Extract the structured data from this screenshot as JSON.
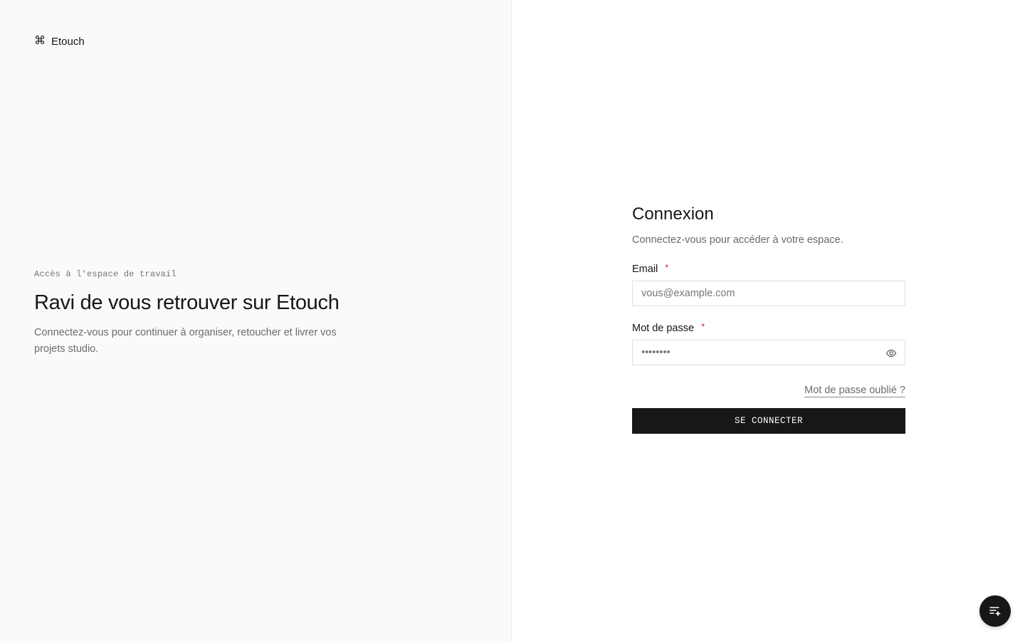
{
  "brand": {
    "icon": "command-icon",
    "icon_glyph": "⌘",
    "name": "Etouch"
  },
  "hero": {
    "eyebrow": "Accès à l'espace de travail",
    "title": "Ravi de vous retrouver sur Etouch",
    "subtitle": "Connectez-vous pour continuer à organiser, retoucher et livrer vos projets studio."
  },
  "form": {
    "title": "Connexion",
    "subtitle": "Connectez-vous pour accéder à votre espace.",
    "email": {
      "label": "Email",
      "required_mark": "*",
      "placeholder": "vous@example.com",
      "value": ""
    },
    "password": {
      "label": "Mot de passe",
      "required_mark": "*",
      "placeholder": "••••••••",
      "value": "",
      "toggle_icon": "eye-icon"
    },
    "forgot_link": "Mot de passe oublié ?",
    "submit_label": "SE CONNECTER"
  },
  "fab": {
    "icon": "list-sparkle-icon"
  },
  "colors": {
    "primary": "#171717",
    "left_panel_bg": "#fafafa",
    "muted_text": "#6b6b6b",
    "required": "#dc2626",
    "border": "#e0e0e0"
  }
}
